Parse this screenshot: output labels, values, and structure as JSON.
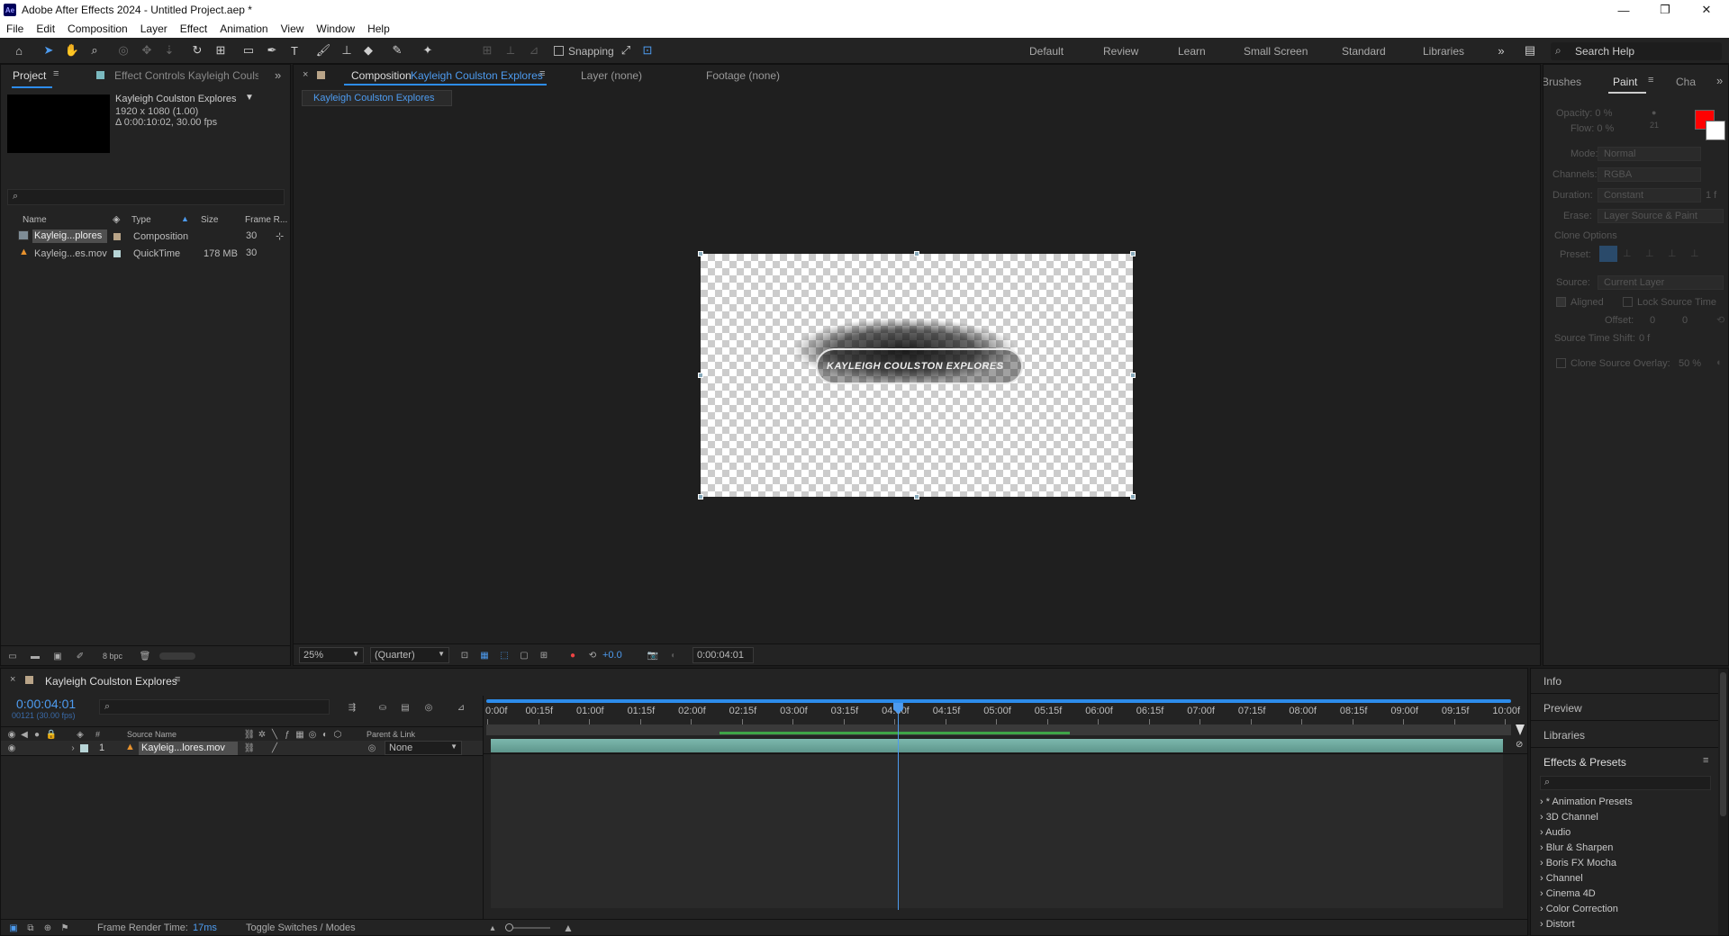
{
  "window": {
    "app_icon": "Ae",
    "title": "Adobe After Effects 2024 - Untitled Project.aep *"
  },
  "menu": [
    "File",
    "Edit",
    "Composition",
    "Layer",
    "Effect",
    "Animation",
    "View",
    "Window",
    "Help"
  ],
  "toolbar": {
    "snapping_label": "Snapping",
    "workspaces": [
      "Default",
      "Review",
      "Learn",
      "Small Screen",
      "Standard",
      "Libraries"
    ],
    "search_placeholder": "Search Help"
  },
  "project_panel": {
    "tab_project": "Project",
    "tab_effect_controls": "Effect Controls Kayleigh Coulstc",
    "comp_name": "Kayleigh Coulston Explores",
    "comp_res": "1920 x 1080 (1.00)",
    "comp_dur": "Δ 0:00:10:02, 30.00 fps",
    "columns": [
      "Name",
      "Type",
      "Size",
      "Frame R..."
    ],
    "items": [
      {
        "name": "Kayleig...plores",
        "type": "Composition",
        "size": "",
        "fr": "30"
      },
      {
        "name": "Kayleig...es.mov",
        "type": "QuickTime",
        "size": "178 MB",
        "fr": "30"
      }
    ],
    "bpc": "8 bpc"
  },
  "viewer": {
    "comp_tab_prefix": "Composition",
    "comp_tab_name": "Kayleigh Coulston Explores",
    "layer_tab": "Layer (none)",
    "footage_tab": "Footage (none)",
    "breadcrumb": "Kayleigh Coulston Explores",
    "overlay_text": "KAYLEIGH COULSTON EXPLORES",
    "zoom": "25%",
    "resolution": "(Quarter)",
    "exposure": "+0.0",
    "timecode": "0:00:04:01"
  },
  "paint_panel": {
    "tab_brushes": "Brushes",
    "tab_paint": "Paint",
    "tab_char": "Cha",
    "opacity": "Opacity: 0 %",
    "flow": "Flow: 0 %",
    "brush_size": "21",
    "mode_label": "Mode:",
    "mode_value": "Normal",
    "channels_label": "Channels:",
    "channels_value": "RGBA",
    "duration_label": "Duration:",
    "duration_value": "Constant",
    "duration_frames": "1 f",
    "erase_label": "Erase:",
    "erase_value": "Layer Source & Paint",
    "clone_options": "Clone Options",
    "preset_label": "Preset:",
    "source_label": "Source:",
    "source_value": "Current Layer",
    "aligned": "Aligned",
    "lock_source": "Lock Source Time",
    "offset_label": "Offset:",
    "offset_x": "0",
    "offset_y": "0",
    "time_shift": "Source Time Shift:",
    "time_shift_value": "0 f",
    "clone_overlay": "Clone Source Overlay:",
    "clone_overlay_value": "50 %",
    "fg_color": "#ff0000",
    "bg_color": "#ffffff"
  },
  "timeline": {
    "comp_tab": "Kayleigh Coulston Explores",
    "timecode": "0:00:04:01",
    "frame_info": "00121 (30.00 fps)",
    "col_num": "#",
    "col_source": "Source Name",
    "col_parent": "Parent & Link",
    "layer": {
      "num": "1",
      "name": "Kayleig...lores.mov",
      "parent": "None"
    },
    "ruler": [
      "0:00f",
      "00:15f",
      "01:00f",
      "01:15f",
      "02:00f",
      "02:15f",
      "03:00f",
      "03:15f",
      "04:00f",
      "04:15f",
      "05:00f",
      "05:15f",
      "06:00f",
      "06:15f",
      "07:00f",
      "07:15f",
      "08:00f",
      "08:15f",
      "09:00f",
      "09:15f",
      "10:00f"
    ],
    "playhead_seconds": 4.033,
    "duration_seconds": 10.067,
    "render_time_label": "Frame Render Time:",
    "render_time_value": "17ms",
    "toggle_label": "Toggle Switches / Modes"
  },
  "right_panel": {
    "info": "Info",
    "preview": "Preview",
    "libraries": "Libraries",
    "effects_presets": "Effects & Presets",
    "effects": [
      "* Animation Presets",
      "3D Channel",
      "Audio",
      "Blur & Sharpen",
      "Boris FX Mocha",
      "Channel",
      "Cinema 4D",
      "Color Correction",
      "Distort"
    ]
  },
  "colors": {
    "accent": "#2d8ceb",
    "playhead": "#4d9bef",
    "layer_bar": "#6ba49a",
    "work_area": "#3fa447"
  }
}
